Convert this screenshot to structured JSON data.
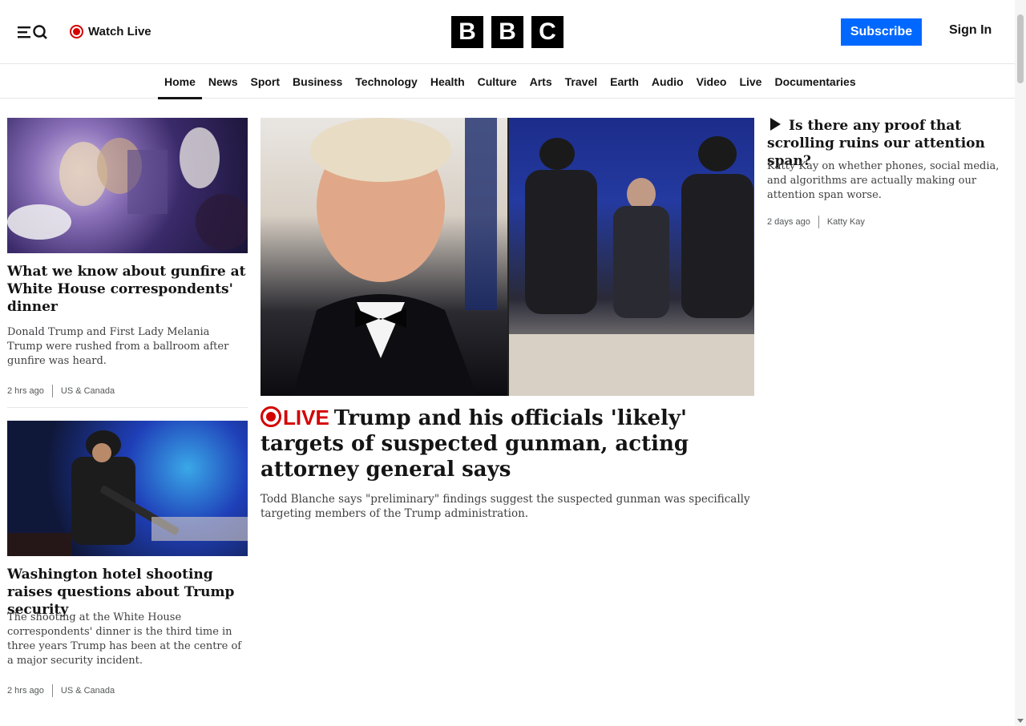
{
  "header": {
    "watch_live_label": "Watch Live",
    "logo_letters": [
      "B",
      "B",
      "C"
    ],
    "subscribe_label": "Subscribe",
    "signin_label": "Sign In"
  },
  "nav": {
    "items": [
      "Home",
      "News",
      "Sport",
      "Business",
      "Technology",
      "Health",
      "Culture",
      "Arts",
      "Travel",
      "Earth",
      "Audio",
      "Video",
      "Live",
      "Documentaries"
    ],
    "active": "Home"
  },
  "stories": {
    "left1": {
      "headline": "What we know about gunfire at White House correspondents' dinner",
      "summary": "Donald Trump and First Lady Melania Trump were rushed from a ballroom after gunfire was heard.",
      "time": "2 hrs ago",
      "section": "US & Canada"
    },
    "left2": {
      "headline": "Washington hotel shooting raises questions about Trump security",
      "summary": "The shooting at the White House correspondents' dinner is the third time in three years Trump has been at the centre of a major security incident.",
      "time": "2 hrs ago",
      "section": "US & Canada"
    },
    "main": {
      "live_label": "LIVE",
      "headline": "Trump and his officials 'likely' targets of suspected gunman, acting attorney general says",
      "summary": "Todd Blanche says \"preliminary\" findings suggest the suspected gunman was specifically targeting members of the Trump administration."
    },
    "side": {
      "headline": "Is there any proof that scrolling ruins our attention span?",
      "summary": "Katty Kay on whether phones, social media, and algorithms are actually making our attention span worse.",
      "time": "2 days ago",
      "author": "Katty Kay"
    }
  },
  "colors": {
    "accent": "#0068ff",
    "live": "#d40000",
    "text": "#141414"
  }
}
